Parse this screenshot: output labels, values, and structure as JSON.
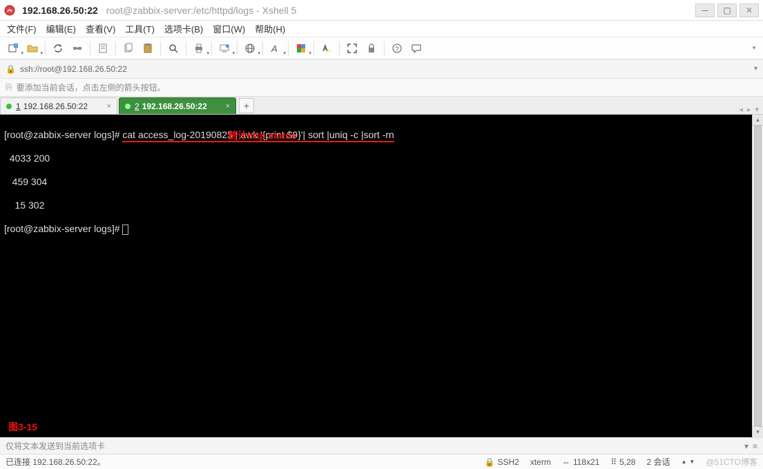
{
  "title": {
    "host": "192.168.26.50:22",
    "session": "root@zabbix-server:/etc/httpd/logs - Xshell 5"
  },
  "menu": {
    "file": "文件(F)",
    "edit": "编辑(E)",
    "view": "查看(V)",
    "tools": "工具(T)",
    "tabs": "选项卡(B)",
    "window": "窗口(W)",
    "help": "帮助(H)"
  },
  "address": {
    "url": "ssh://root@192.168.26.50:22"
  },
  "hint": {
    "text": "要添加当前会话，点击左侧的箭头按钮。"
  },
  "tabs": {
    "t1_num": "1",
    "t1_label": "192.168.26.50:22",
    "t2_num": "2",
    "t2_label": "192.168.26.50:22"
  },
  "terminal": {
    "prompt": "[root@zabbix-server logs]# ",
    "cmd": "cat access_log-20190825 | awk '{print $9}'| sort |uniq -c |sort -rn",
    "out1": "  4033 200",
    "out2": "   459 304",
    "out3": "    15 302",
    "prompt2": "[root@zabbix-server logs]# ",
    "annotation": "统计http status",
    "fig": "图3-15"
  },
  "inputhint": {
    "text": "仅将文本发送到当前选项卡"
  },
  "status": {
    "conn": "已连接 192.168.26.50:22。",
    "proto": "SSH2",
    "term": "xterm",
    "size": "118x21",
    "cursor": "5,28",
    "sessions": "2 会话",
    "watermark": "@51CTO博客"
  },
  "icons": {
    "lock": "🔒",
    "arrow": "↗"
  }
}
